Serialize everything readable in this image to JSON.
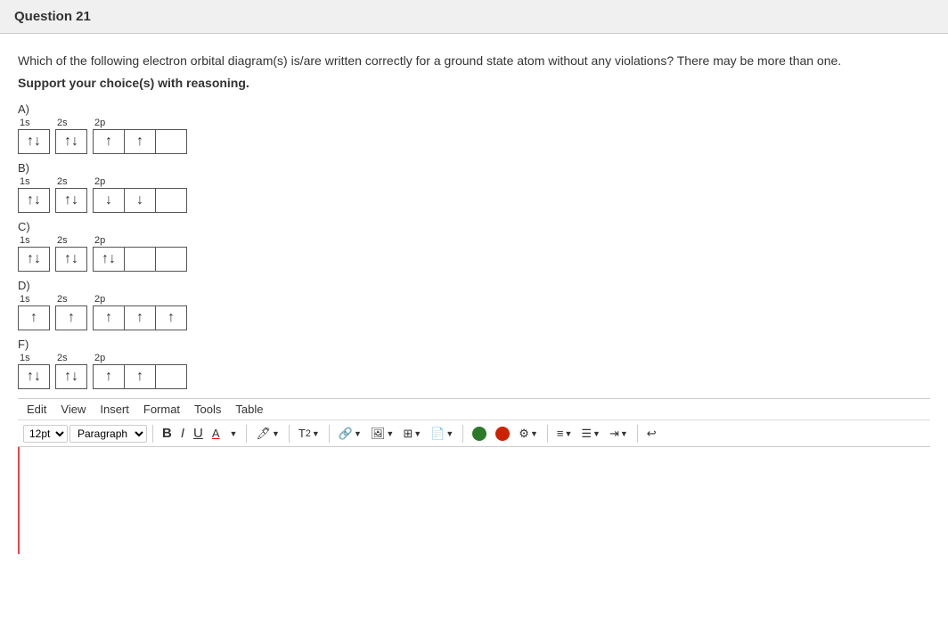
{
  "header": {
    "title": "Question 21"
  },
  "question": {
    "text": "Which of the following electron orbital diagram(s) is/are written correctly for a ground state atom without any violations? There may be more than one.",
    "support_text": "Support your choice(s) with reasoning."
  },
  "diagrams": [
    {
      "label": "A)",
      "groups": [
        {
          "sublabel": "1s",
          "boxes": [
            "↑↓"
          ]
        },
        {
          "sublabel": "2s",
          "boxes": [
            "↑↓"
          ]
        },
        {
          "sublabel": "2p",
          "boxes": [
            "↑",
            "↑",
            ""
          ]
        }
      ]
    },
    {
      "label": "B)",
      "groups": [
        {
          "sublabel": "1s",
          "boxes": [
            "↑↓"
          ]
        },
        {
          "sublabel": "2s",
          "boxes": [
            "↑↓"
          ]
        },
        {
          "sublabel": "2p",
          "boxes": [
            "↓",
            "↓",
            ""
          ]
        }
      ]
    },
    {
      "label": "C)",
      "groups": [
        {
          "sublabel": "1s",
          "boxes": [
            "↑↓"
          ]
        },
        {
          "sublabel": "2s",
          "boxes": [
            "↑↓"
          ]
        },
        {
          "sublabel": "2p",
          "boxes": [
            "↑↓",
            "",
            ""
          ]
        }
      ]
    },
    {
      "label": "D)",
      "groups": [
        {
          "sublabel": "1s",
          "boxes": [
            "↑"
          ]
        },
        {
          "sublabel": "2s",
          "boxes": [
            "↑"
          ]
        },
        {
          "sublabel": "2p",
          "boxes": [
            "↑",
            "↑",
            "↑"
          ]
        }
      ]
    },
    {
      "label": "F)",
      "groups": [
        {
          "sublabel": "1s",
          "boxes": [
            "↑↓"
          ]
        },
        {
          "sublabel": "2s",
          "boxes": [
            "↑↓"
          ]
        },
        {
          "sublabel": "2p",
          "boxes": [
            "↑",
            "↑",
            ""
          ]
        }
      ]
    }
  ],
  "menu": {
    "items": [
      "Edit",
      "View",
      "Insert",
      "Format",
      "Tools",
      "Table"
    ]
  },
  "toolbar": {
    "font_size": "12pt",
    "paragraph": "Paragraph",
    "bold": "B",
    "italic": "I",
    "underline": "U",
    "font_color": "A"
  },
  "editor": {
    "placeholder": ""
  }
}
